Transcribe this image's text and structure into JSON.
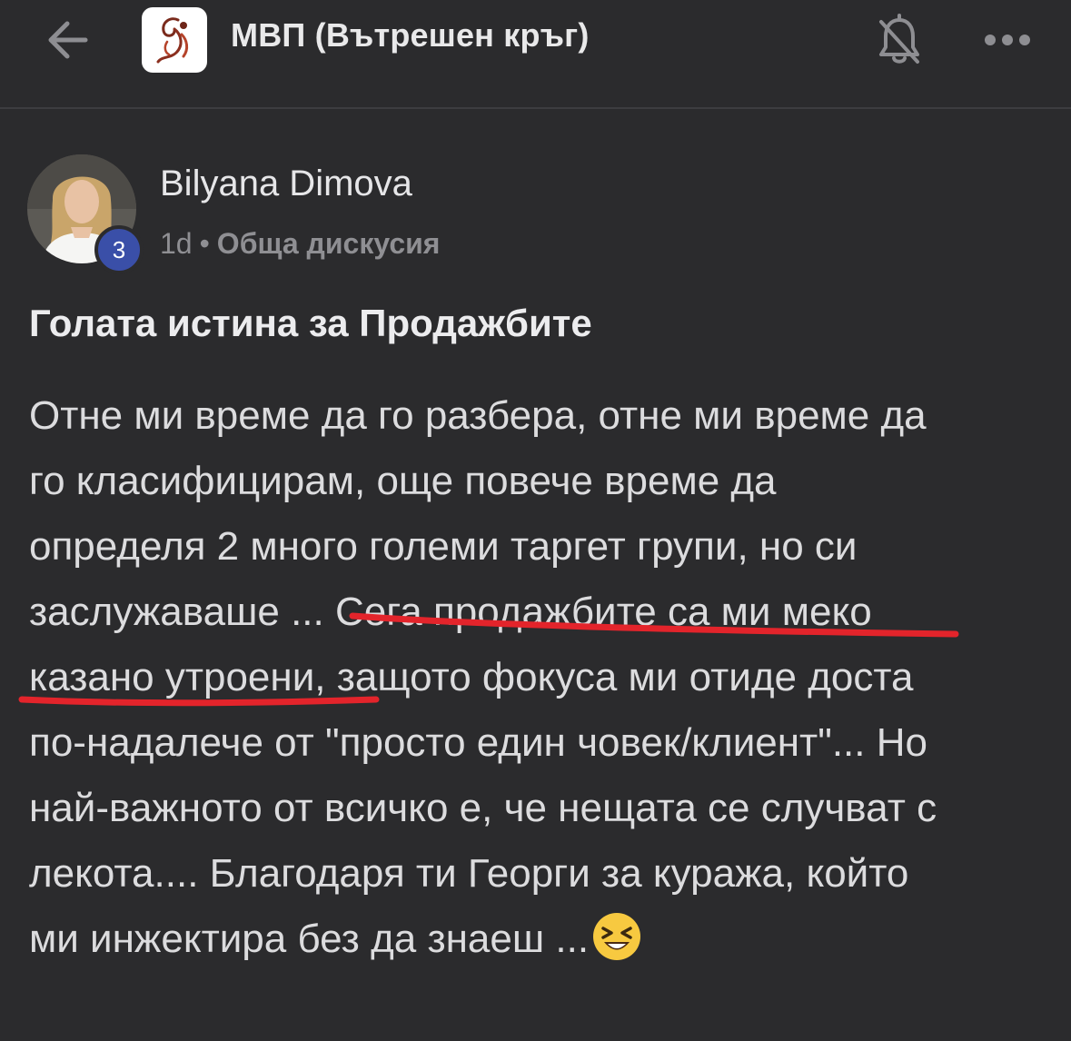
{
  "header": {
    "back_icon": "arrow-left-icon",
    "group_logo_icon": "group-logo",
    "group_title": "МВП (Вътрешен кръг)",
    "bell_icon": "bell-off-icon",
    "more_icon": "more-horizontal-icon"
  },
  "post": {
    "author": {
      "name": "Bilyana Dimova",
      "level": "3",
      "avatar_icon": "avatar"
    },
    "time": "1d",
    "separator": "•",
    "category": "Обща дискусия",
    "title": "Голата истина за Продажбите",
    "body_lines": [
      "Отне ми време да го разбера, отне ми време да",
      "го класифицирам, още повече време да",
      "определя 2 много големи таргет групи, но си",
      "заслужаваше ... Сега продажбите са ми меко",
      "казано утроени, защото фокуса ми отиде доста",
      "по-надалече от \"просто един човек/клиент\"... Но",
      "най-важното от всичко е, че нещата се случват с",
      "лекота.... Благодаря ти Георги за куража, който",
      "ми инжектира без да знаеш ..."
    ],
    "emoji_icon": "laughing-emoji-icon",
    "annotation_color": "#e3242b"
  }
}
